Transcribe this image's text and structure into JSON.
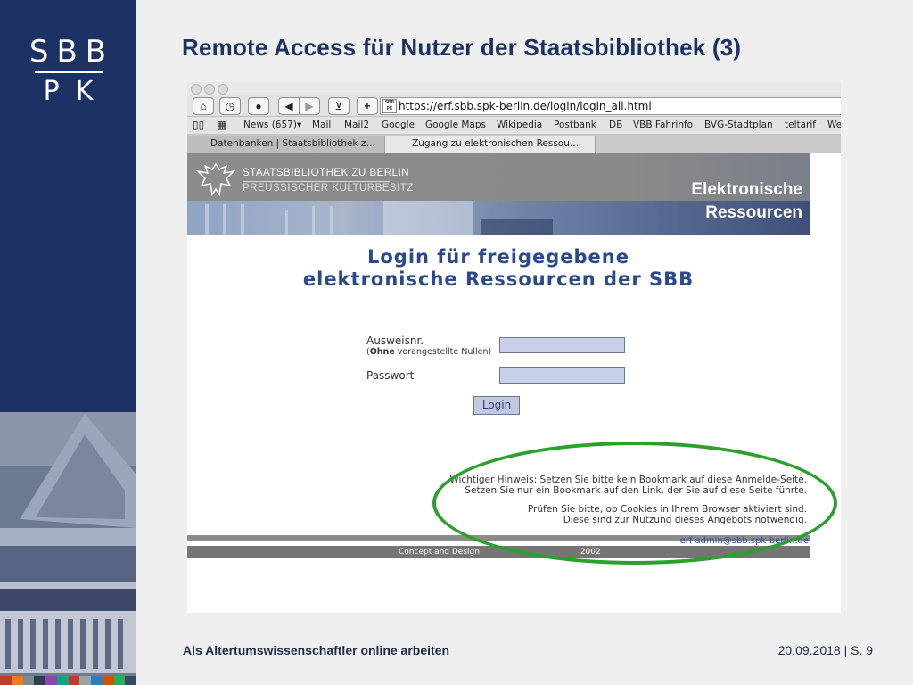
{
  "brand": {
    "line1": "SBB",
    "line2": "PK"
  },
  "slide": {
    "title": "Remote Access für Nutzer der Staatsbibliothek (3)",
    "footer_left": "Als Altertumswissenschaftler online arbeiten",
    "footer_right": "20.09.2018 | S. 9"
  },
  "colors": {
    "navy": "#1c3264",
    "highlight": "#2ca02c",
    "link": "#2a4aa0",
    "color_bar": [
      "#c0392b",
      "#e67e22",
      "#7f8c8d",
      "#2c3e50",
      "#8e44ad",
      "#16a085",
      "#c0392b",
      "#95a5a6",
      "#2980b9",
      "#d35400",
      "#27ae60",
      "#34495e"
    ]
  },
  "browser": {
    "url": "https://erf.sbb.spk-berlin.de/login/login_all.html",
    "url_icon_text": "SBB PK",
    "toolbar_icons": [
      "home-icon",
      "history-icon",
      "download-icon",
      "back-icon",
      "forward-icon",
      "bookmark-add-icon",
      "new-tab-icon"
    ],
    "bookmarks": [
      "News (657)▾",
      "Mail",
      "Mail2",
      "Google",
      "Google Maps",
      "Wikipedia",
      "Postbank",
      "DB",
      "VBB Fahrinfo",
      "BVG-Stadtplan",
      "teltarif",
      "We"
    ],
    "tabs": [
      {
        "label": "Datenbanken | Staatsbibliothek z…",
        "active": false
      },
      {
        "label": "Zugang zu elektronischen Ressou…",
        "active": true
      }
    ]
  },
  "web": {
    "banner_name_1": "STAATSBIBLIOTHEK ZU BERLIN",
    "banner_name_2": "PREUSSISCHER KULTURBESITZ",
    "banner_heading_1": "Elektronische",
    "banner_heading_2": "Ressourcen",
    "login_title_1": "Login für freigegebene",
    "login_title_2": "elektronische Ressourcen der SBB",
    "card_label": "Ausweisnr.",
    "card_hint_bold": "Ohne",
    "card_hint_rest": " vorangestellte Nullen)",
    "card_hint_open": "(",
    "card_value": "",
    "password_label": "Passwort",
    "password_value": "",
    "login_button": "Login",
    "note_1": "Wichtiger Hinweis: Setzen Sie bitte kein Bookmark auf diese Anmelde-Seite.",
    "note_2": "Setzen Sie nur ein Bookmark auf den Link, der Sie auf diese Seite führte.",
    "note_3": "Prüfen Sie bitte, ob Cookies in Ihrem Browser aktiviert sind.",
    "note_4": "Diese sind zur Nutzung dieses Angebots notwendig.",
    "footer_email": "erf-admin@sbb.spk-berlin.de",
    "footer_credit": "Concept and Design",
    "footer_credit_year": "2002"
  }
}
